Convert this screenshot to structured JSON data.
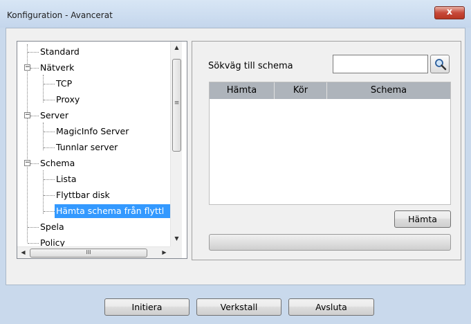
{
  "window": {
    "title": "Konfiguration - Avancerat",
    "close_label": "x"
  },
  "tree": {
    "items": [
      {
        "label": "Standard"
      },
      {
        "label": "Nätverk",
        "expander": "−"
      },
      {
        "label": "TCP"
      },
      {
        "label": "Proxy"
      },
      {
        "label": "Server",
        "expander": "−"
      },
      {
        "label": "MagicInfo Server"
      },
      {
        "label": "Tunnlar server"
      },
      {
        "label": "Schema",
        "expander": "−"
      },
      {
        "label": "Lista"
      },
      {
        "label": "Flyttbar disk"
      },
      {
        "label": "Hämta schema från flyttl"
      },
      {
        "label": "Spela"
      },
      {
        "label": "Policy"
      }
    ],
    "selected_index": 10,
    "hscroll_grip": "III",
    "arrow_up": "▲",
    "arrow_down": "▼",
    "arrow_left": "◀",
    "arrow_right": "▶",
    "vscroll_grip": "≡"
  },
  "schedule": {
    "path_label": "Sökväg till schema",
    "path_value": "",
    "search_icon": "magnifier-icon",
    "columns": [
      "Hämta",
      "Kör",
      "Schema"
    ],
    "fetch_button": "Hämta",
    "progress": 0
  },
  "footer": {
    "init_button": "Initiera",
    "apply_button": "Verkstall",
    "quit_button": "Avsluta"
  }
}
